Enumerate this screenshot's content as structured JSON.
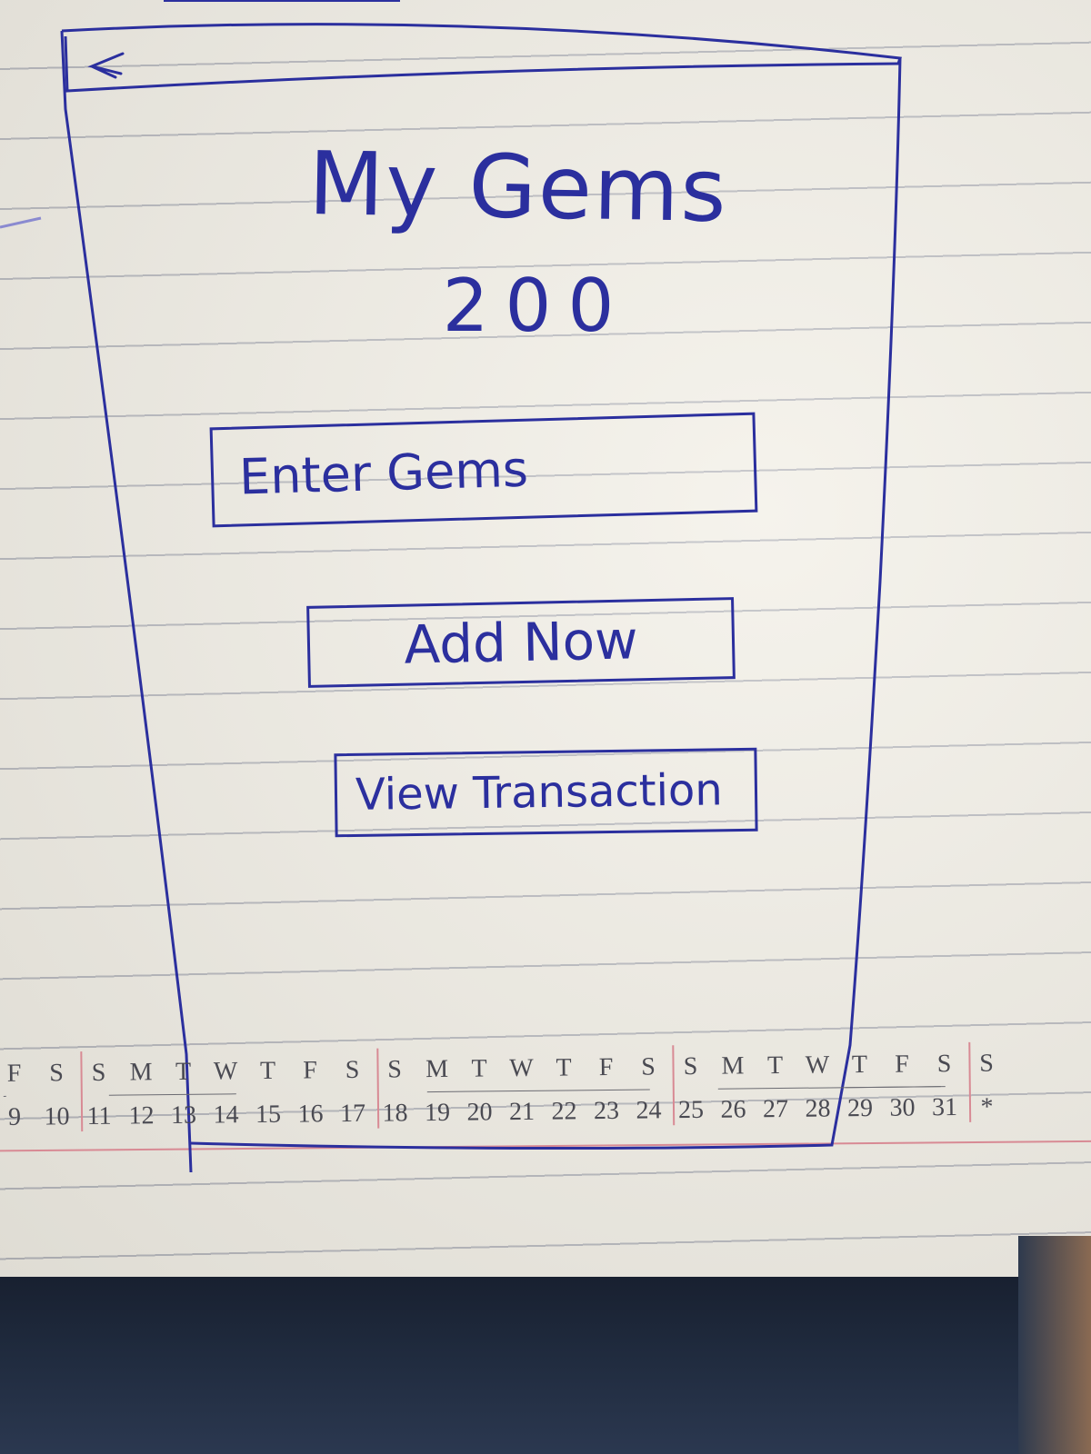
{
  "screen": {
    "back_icon": "chevron-left-icon",
    "title": "My Gems",
    "gem_count": "200",
    "gems_input": {
      "placeholder": "Enter Gems",
      "value": ""
    },
    "add_button_label": "Add Now",
    "view_transaction_label": "View Transaction"
  },
  "paper_calendar": {
    "days": [
      "F",
      "S",
      "S",
      "M",
      "T",
      "W",
      "T",
      "F",
      "S",
      "S",
      "M",
      "T",
      "W",
      "T",
      "F",
      "S",
      "S",
      "M",
      "T",
      "W",
      "T",
      "F",
      "S",
      "S"
    ],
    "dates": [
      "9",
      "10",
      "11",
      "12",
      "13",
      "14",
      "15",
      "16",
      "17",
      "18",
      "19",
      "20",
      "21",
      "22",
      "23",
      "24",
      "25",
      "26",
      "27",
      "28",
      "29",
      "30",
      "31",
      "*"
    ]
  },
  "colors": {
    "ink": "#2b2f9e",
    "paper": "#f2efe6",
    "rule": "#b7b8bd",
    "margin_line": "#d88a94"
  }
}
